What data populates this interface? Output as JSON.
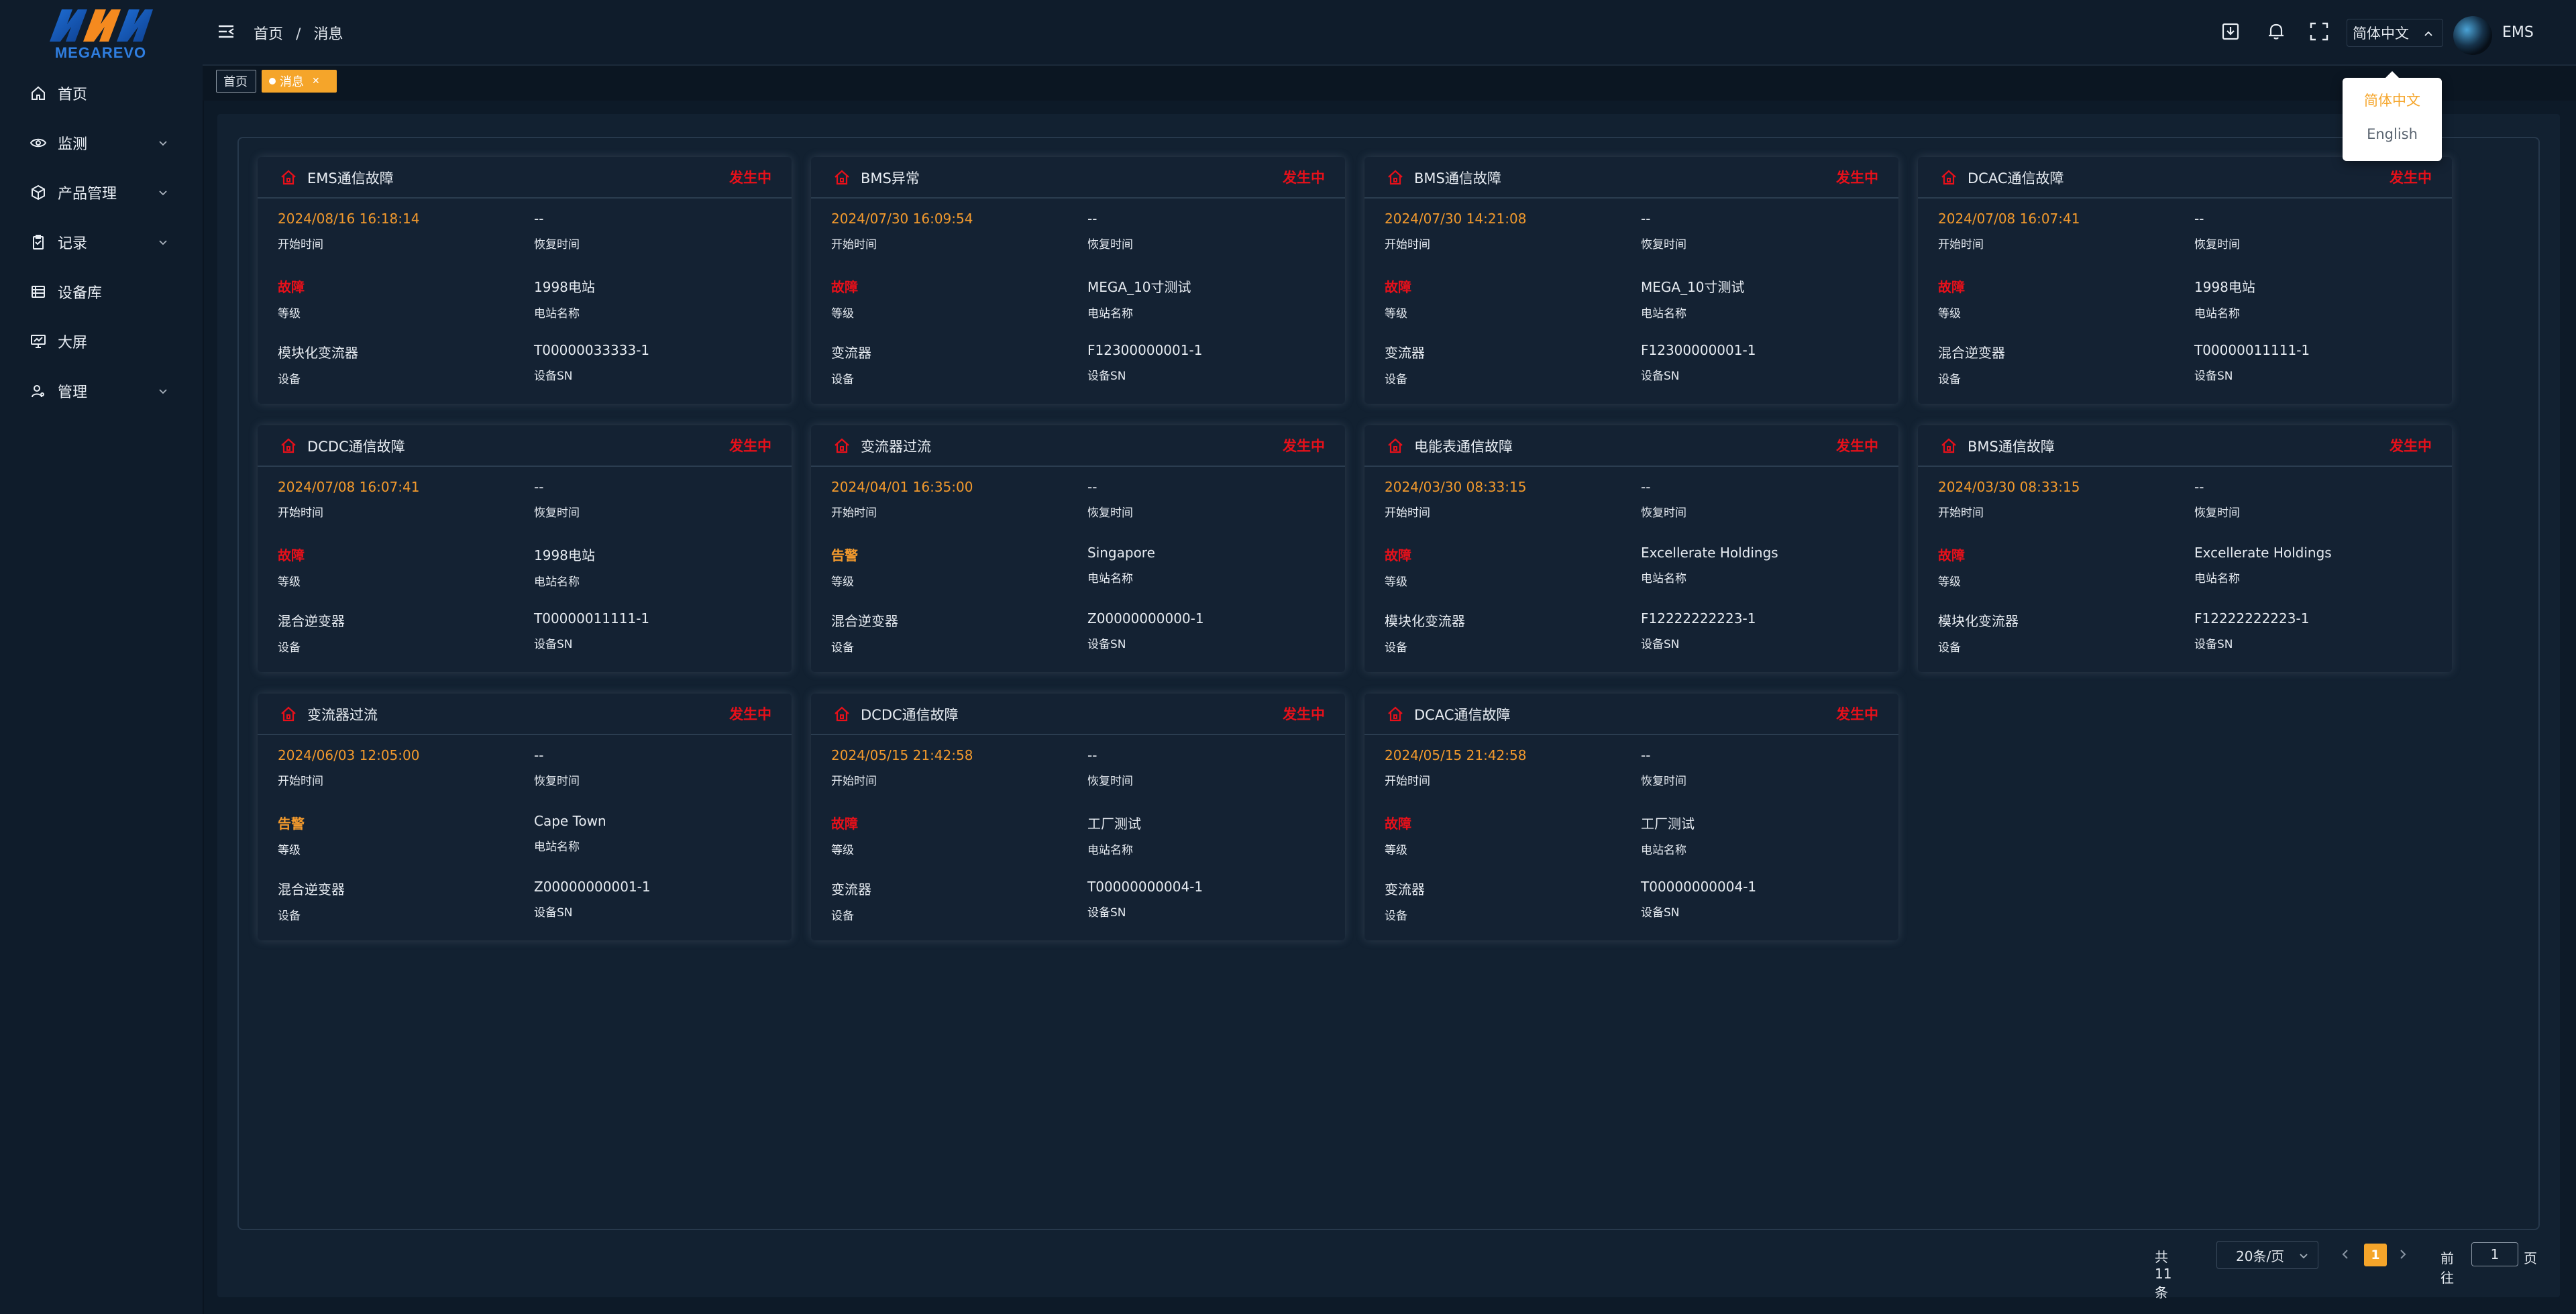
{
  "brand": {
    "logo_text": "MEGAREVO"
  },
  "sidebar": {
    "items": [
      {
        "label": "首页",
        "icon": "home-icon",
        "expandable": false
      },
      {
        "label": "监测",
        "icon": "eye-icon",
        "expandable": true
      },
      {
        "label": "产品管理",
        "icon": "box-icon",
        "expandable": true
      },
      {
        "label": "记录",
        "icon": "clipboard-icon",
        "expandable": true
      },
      {
        "label": "设备库",
        "icon": "list-icon",
        "expandable": false
      },
      {
        "label": "大屏",
        "icon": "screen-icon",
        "expandable": false
      },
      {
        "label": "管理",
        "icon": "user-settings-icon",
        "expandable": true
      }
    ]
  },
  "header": {
    "breadcrumb": [
      "首页",
      "消息"
    ],
    "language": "简体中文",
    "username": "EMS"
  },
  "tags": {
    "home": "首页",
    "current": "消息"
  },
  "lang_dropdown": {
    "options": [
      "简体中文",
      "English"
    ],
    "selected": "简体中文"
  },
  "colors": {
    "accent": "#f5a52a",
    "danger": "#e8101a",
    "background": "#0d1a28",
    "card": "#142233"
  },
  "labels": {
    "start": "开始时间",
    "recover": "恢复时间",
    "level": "等级",
    "station": "电站名称",
    "device": "设备",
    "sn": "设备SN"
  },
  "cards": [
    {
      "title": "EMS通信故障",
      "status": "发生中",
      "start": "2024/08/16 16:18:14",
      "recover": "--",
      "level": "故障",
      "level_type": "fault",
      "station": "1998电站",
      "device": "模块化变流器",
      "sn": "T00000033333-1"
    },
    {
      "title": "BMS异常",
      "status": "发生中",
      "start": "2024/07/30 16:09:54",
      "recover": "--",
      "level": "故障",
      "level_type": "fault",
      "station": "MEGA_10寸测试",
      "device": "变流器",
      "sn": "F12300000001-1"
    },
    {
      "title": "BMS通信故障",
      "status": "发生中",
      "start": "2024/07/30 14:21:08",
      "recover": "--",
      "level": "故障",
      "level_type": "fault",
      "station": "MEGA_10寸测试",
      "device": "变流器",
      "sn": "F12300000001-1"
    },
    {
      "title": "DCAC通信故障",
      "status": "发生中",
      "start": "2024/07/08 16:07:41",
      "recover": "--",
      "level": "故障",
      "level_type": "fault",
      "station": "1998电站",
      "device": "混合逆变器",
      "sn": "T00000011111-1"
    },
    {
      "title": "DCDC通信故障",
      "status": "发生中",
      "start": "2024/07/08 16:07:41",
      "recover": "--",
      "level": "故障",
      "level_type": "fault",
      "station": "1998电站",
      "device": "混合逆变器",
      "sn": "T00000011111-1"
    },
    {
      "title": "变流器过流",
      "status": "发生中",
      "start": "2024/04/01 16:35:00",
      "recover": "--",
      "level": "告警",
      "level_type": "warn",
      "station": "Singapore",
      "device": "混合逆变器",
      "sn": "Z00000000000-1"
    },
    {
      "title": "电能表通信故障",
      "status": "发生中",
      "start": "2024/03/30 08:33:15",
      "recover": "--",
      "level": "故障",
      "level_type": "fault",
      "station": "Excellerate Holdings",
      "device": "模块化变流器",
      "sn": "F12222222223-1"
    },
    {
      "title": "BMS通信故障",
      "status": "发生中",
      "start": "2024/03/30 08:33:15",
      "recover": "--",
      "level": "故障",
      "level_type": "fault",
      "station": "Excellerate Holdings",
      "device": "模块化变流器",
      "sn": "F12222222223-1"
    },
    {
      "title": "变流器过流",
      "status": "发生中",
      "start": "2024/06/03 12:05:00",
      "recover": "--",
      "level": "告警",
      "level_type": "warn",
      "station": "Cape Town",
      "device": "混合逆变器",
      "sn": "Z00000000001-1"
    },
    {
      "title": "DCDC通信故障",
      "status": "发生中",
      "start": "2024/05/15 21:42:58",
      "recover": "--",
      "level": "故障",
      "level_type": "fault",
      "station": "工厂测试",
      "device": "变流器",
      "sn": "T00000000004-1"
    },
    {
      "title": "DCAC通信故障",
      "status": "发生中",
      "start": "2024/05/15 21:42:58",
      "recover": "--",
      "level": "故障",
      "level_type": "fault",
      "station": "工厂测试",
      "device": "变流器",
      "sn": "T00000000004-1"
    }
  ],
  "pagination": {
    "total_text": "共 11 条",
    "page_size": "20条/页",
    "current_page": "1",
    "goto_label": "前往",
    "goto_value": "1",
    "goto_suffix": "页"
  }
}
